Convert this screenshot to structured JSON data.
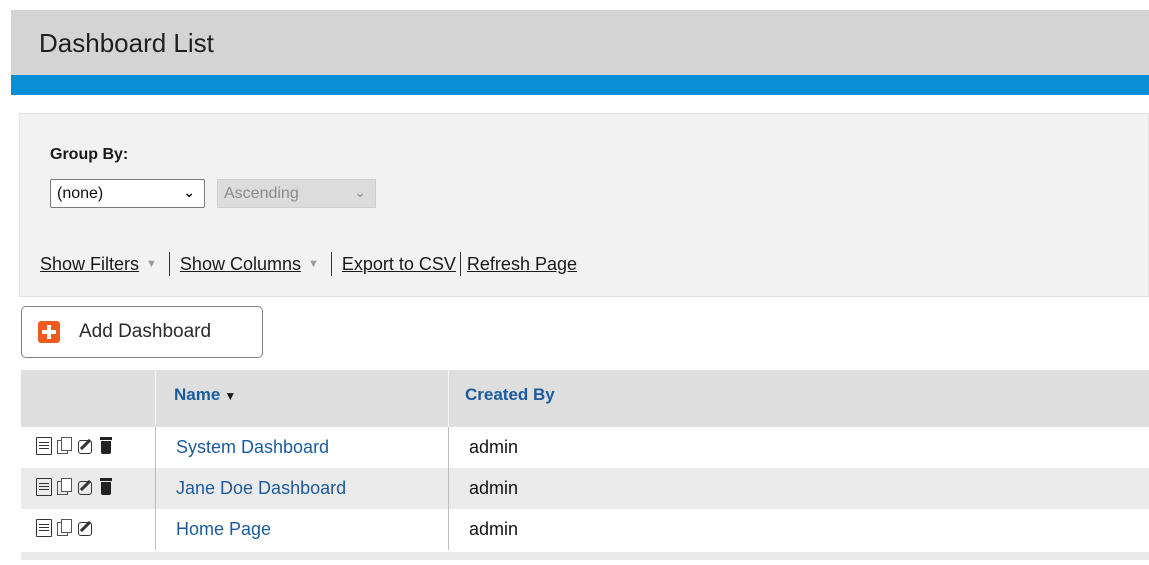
{
  "page": {
    "title": "Dashboard List"
  },
  "filters": {
    "group_by_label": "Group By:",
    "group_by_value": "(none)",
    "order_value": "Ascending",
    "show_filters": "Show Filters",
    "show_columns": "Show Columns",
    "export_csv": "Export to CSV",
    "refresh_page": "Refresh Page"
  },
  "toolbar": {
    "add_label": "Add Dashboard"
  },
  "table": {
    "columns": [
      "Name",
      "Created By"
    ],
    "rows": [
      {
        "name": "System Dashboard",
        "created_by": "admin",
        "actions": [
          "view-icon",
          "copy-icon",
          "edit-icon",
          "delete-icon"
        ]
      },
      {
        "name": "Jane Doe Dashboard",
        "created_by": "admin",
        "actions": [
          "view-icon",
          "copy-icon",
          "edit-icon",
          "delete-icon"
        ]
      },
      {
        "name": "Home Page",
        "created_by": "admin",
        "actions": [
          "view-icon",
          "copy-icon",
          "edit-icon"
        ]
      }
    ]
  },
  "colors": {
    "accent_bar": "#0a8fd6",
    "link": "#1a5b9e",
    "add_icon": "#f05a1e"
  }
}
